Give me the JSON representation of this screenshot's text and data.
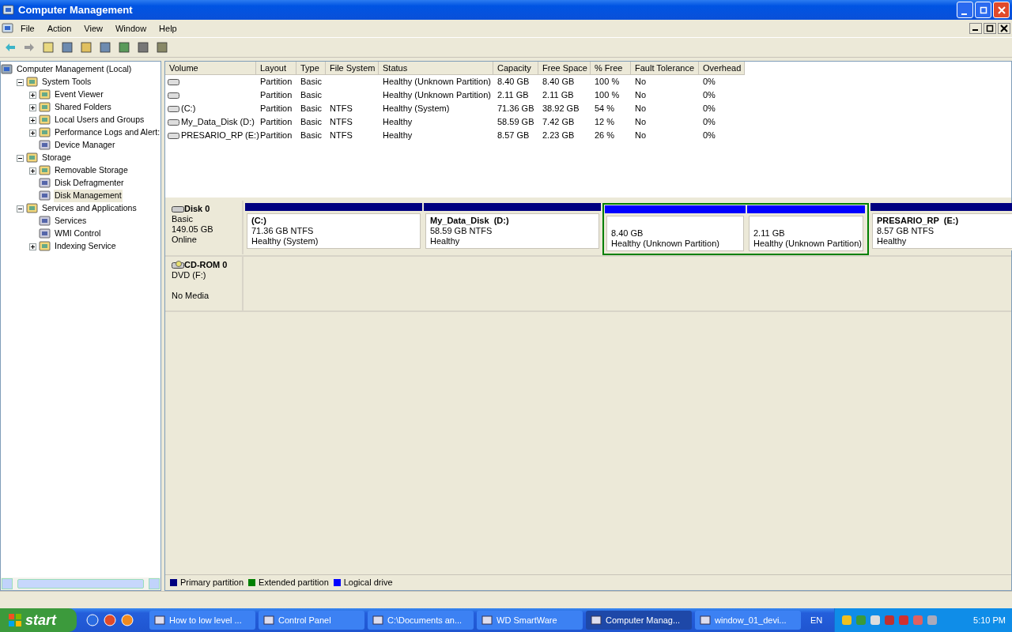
{
  "window": {
    "title": "Computer Management"
  },
  "menu": [
    "File",
    "Action",
    "View",
    "Window",
    "Help"
  ],
  "tree": [
    {
      "label": "Computer Management (Local)",
      "kind": "root",
      "selected": false,
      "children": [
        {
          "label": "System Tools",
          "kind": "folder",
          "expanded": true,
          "selected": false,
          "children": [
            {
              "label": "Event Viewer",
              "kind": "folder",
              "expanded": false,
              "selected": false
            },
            {
              "label": "Shared Folders",
              "kind": "folder",
              "expanded": false,
              "selected": false
            },
            {
              "label": "Local Users and Groups",
              "kind": "folder",
              "expanded": false,
              "selected": false
            },
            {
              "label": "Performance Logs and Alert:",
              "kind": "folder",
              "expanded": false,
              "selected": false
            },
            {
              "label": "Device Manager",
              "kind": "leaf",
              "selected": false
            }
          ]
        },
        {
          "label": "Storage",
          "kind": "folder",
          "expanded": true,
          "selected": false,
          "children": [
            {
              "label": "Removable Storage",
              "kind": "folder",
              "expanded": false,
              "selected": false
            },
            {
              "label": "Disk Defragmenter",
              "kind": "leaf",
              "selected": false
            },
            {
              "label": "Disk Management",
              "kind": "leaf",
              "selected": true
            }
          ]
        },
        {
          "label": "Services and Applications",
          "kind": "folder",
          "expanded": true,
          "selected": false,
          "children": [
            {
              "label": "Services",
              "kind": "leaf",
              "selected": false
            },
            {
              "label": "WMI Control",
              "kind": "leaf",
              "selected": false
            },
            {
              "label": "Indexing Service",
              "kind": "folder",
              "expanded": false,
              "selected": false
            }
          ]
        }
      ]
    }
  ],
  "volumes": {
    "columns": [
      "Volume",
      "Layout",
      "Type",
      "File System",
      "Status",
      "Capacity",
      "Free Space",
      "% Free",
      "Fault Tolerance",
      "Overhead"
    ],
    "rows": [
      [
        "",
        "Partition",
        "Basic",
        "",
        "Healthy (Unknown Partition)",
        "8.40 GB",
        "8.40 GB",
        "100 %",
        "No",
        "0%"
      ],
      [
        "",
        "Partition",
        "Basic",
        "",
        "Healthy (Unknown Partition)",
        "2.11 GB",
        "2.11 GB",
        "100 %",
        "No",
        "0%"
      ],
      [
        "(C:)",
        "Partition",
        "Basic",
        "NTFS",
        "Healthy (System)",
        "71.36 GB",
        "38.92 GB",
        "54 %",
        "No",
        "0%"
      ],
      [
        "My_Data_Disk (D:)",
        "Partition",
        "Basic",
        "NTFS",
        "Healthy",
        "58.59 GB",
        "7.42 GB",
        "12 %",
        "No",
        "0%"
      ],
      [
        "PRESARIO_RP (E:)",
        "Partition",
        "Basic",
        "NTFS",
        "Healthy",
        "8.57 GB",
        "2.23 GB",
        "26 %",
        "No",
        "0%"
      ]
    ]
  },
  "disks": [
    {
      "name": "Disk 0",
      "kind": "disk",
      "lines": [
        "Basic",
        "149.05 GB"
      ],
      "status": "Online",
      "partitions": [
        {
          "kind": "primary",
          "title": "(C:)",
          "size": "71.36 GB NTFS",
          "status": "Healthy (System)"
        },
        {
          "kind": "primary",
          "title": "My_Data_Disk  (D:)",
          "size": "58.59 GB NTFS",
          "status": "Healthy"
        },
        {
          "kind": "extended",
          "children": [
            {
              "kind": "logical",
              "size": "8.40 GB",
              "status": "Healthy (Unknown Partition)"
            },
            {
              "kind": "logical",
              "size": "2.11 GB",
              "status": "Healthy (Unknown Partition)"
            }
          ]
        },
        {
          "kind": "primary",
          "title": "PRESARIO_RP  (E:)",
          "size": "8.57 GB NTFS",
          "status": "Healthy"
        }
      ]
    },
    {
      "name": "CD-ROM 0",
      "kind": "cdrom",
      "lines": [
        "DVD (F:)"
      ],
      "status": "No Media"
    }
  ],
  "legend": [
    {
      "label": "Primary partition",
      "color": "#000080"
    },
    {
      "label": "Extended partition",
      "color": "#008000"
    },
    {
      "label": "Logical drive",
      "color": "#0000ff"
    }
  ],
  "taskbar": {
    "start": "start",
    "tasks": [
      {
        "label": "How to low level ...",
        "selected": false
      },
      {
        "label": "Control Panel",
        "selected": false
      },
      {
        "label": "C:\\Documents an...",
        "selected": false
      },
      {
        "label": "WD SmartWare",
        "selected": false
      },
      {
        "label": "Computer Manag...",
        "selected": true
      },
      {
        "label": "window_01_devi...",
        "selected": false
      }
    ],
    "language": "EN",
    "time": "5:10 PM"
  }
}
